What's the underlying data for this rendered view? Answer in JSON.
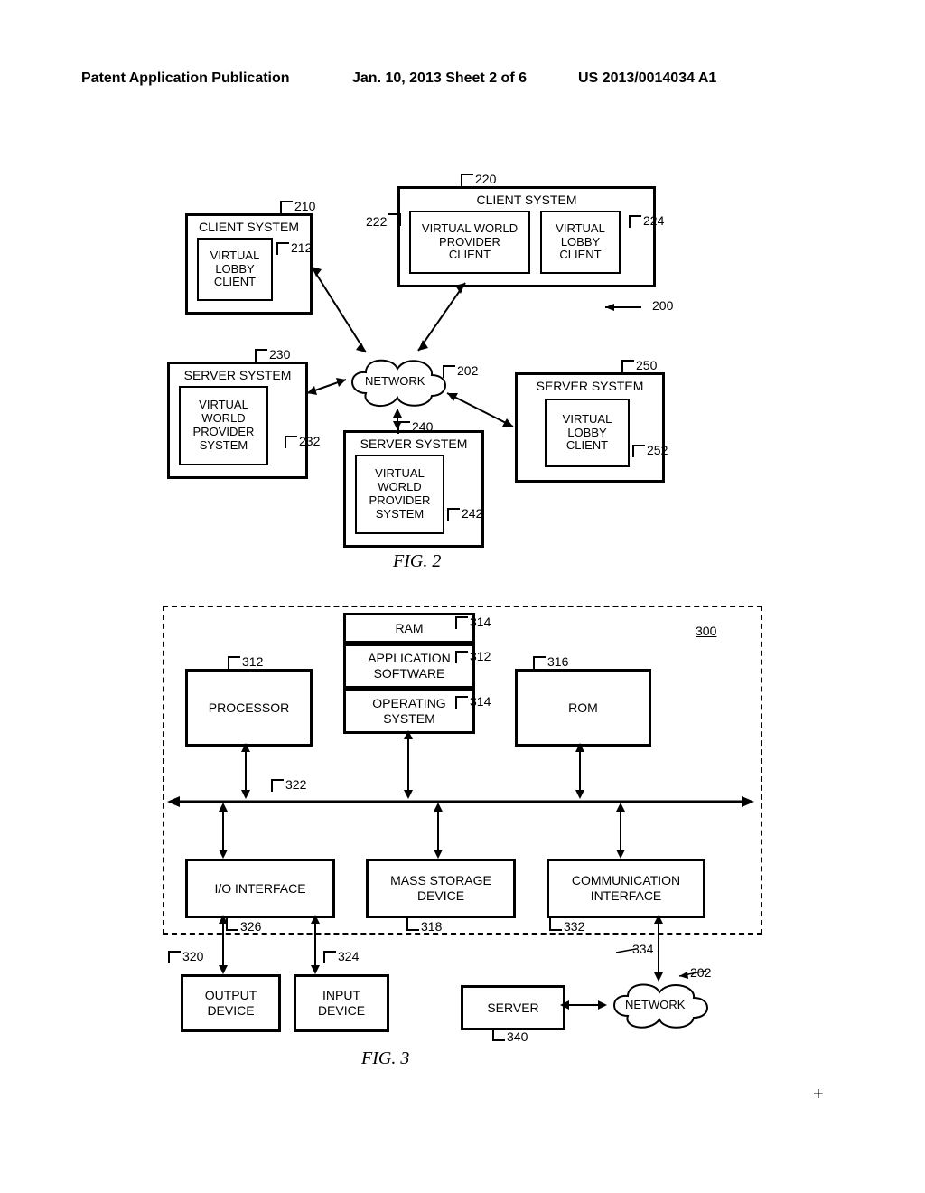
{
  "header": {
    "left": "Patent Application Publication",
    "middle": "Jan. 10, 2013  Sheet 2 of 6",
    "right": "US 2013/0014034 A1"
  },
  "fig2": {
    "caption": "FIG. 2",
    "network": "NETWORK",
    "sys200": "200",
    "client210": {
      "title": "CLIENT SYSTEM",
      "ref": "210",
      "module": "VIRTUAL\nLOBBY\nCLIENT",
      "mref": "212"
    },
    "client220": {
      "title": "CLIENT SYSTEM",
      "ref": "220",
      "left": "VIRTUAL WORLD\nPROVIDER\nCLIENT",
      "lref": "222",
      "right": "VIRTUAL\nLOBBY\nCLIENT",
      "rref": "224"
    },
    "server230": {
      "title": "SERVER SYSTEM",
      "ref": "230",
      "module": "VIRTUAL\nWORLD\nPROVIDER\nSYSTEM",
      "mref": "232"
    },
    "server240": {
      "title": "SERVER SYSTEM",
      "ref": "240",
      "module": "VIRTUAL\nWORLD\nPROVIDER\nSYSTEM",
      "mref": "242"
    },
    "server250": {
      "title": "SERVER SYSTEM",
      "ref": "250",
      "module": "VIRTUAL\nLOBBY\nCLIENT",
      "mref": "252"
    },
    "netref": "202"
  },
  "fig3": {
    "caption": "FIG. 3",
    "sys": "300",
    "processor": {
      "t": "PROCESSOR",
      "r": "312"
    },
    "ram": {
      "t": "RAM",
      "r": "314"
    },
    "app": {
      "t": "APPLICATION\nSOFTWARE",
      "r": "312"
    },
    "os": {
      "t": "OPERATING\nSYSTEM",
      "r": "314"
    },
    "rom": {
      "t": "ROM",
      "r": "316"
    },
    "bus": "322",
    "io": {
      "t": "I/O INTERFACE",
      "r": "326"
    },
    "mass": {
      "t": "MASS STORAGE\nDEVICE",
      "r": "318"
    },
    "comm": {
      "t": "COMMUNICATION\nINTERFACE",
      "r": "332"
    },
    "output": {
      "t": "OUTPUT\nDEVICE",
      "r": "320"
    },
    "input": {
      "t": "INPUT\nDEVICE",
      "r": "324"
    },
    "server": {
      "t": "SERVER",
      "r": "340"
    },
    "network": {
      "t": "NETWORK",
      "r": "202"
    },
    "link334": "334"
  }
}
